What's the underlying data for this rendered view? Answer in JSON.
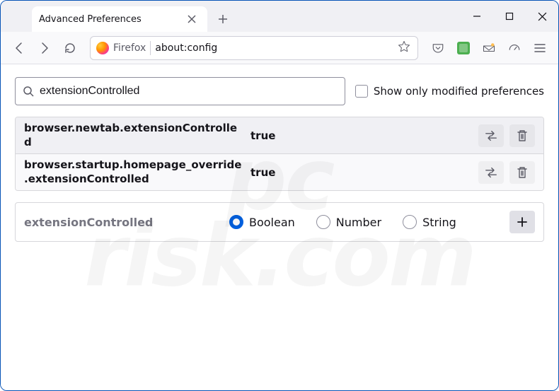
{
  "window": {
    "tab_title": "Advanced Preferences"
  },
  "toolbar": {
    "identity_label": "Firefox",
    "url": "about:config"
  },
  "search": {
    "value": "extensionControlled",
    "modified_label": "Show only modified preferences"
  },
  "prefs": [
    {
      "name": "browser.newtab.extensionControlled",
      "value": "true"
    },
    {
      "name": "browser.startup.homepage_override.extensionControlled",
      "value": "true"
    }
  ],
  "add": {
    "name": "extensionControlled",
    "options": [
      "Boolean",
      "Number",
      "String"
    ],
    "selected": "Boolean"
  },
  "watermark": "pc\nrisk.com"
}
